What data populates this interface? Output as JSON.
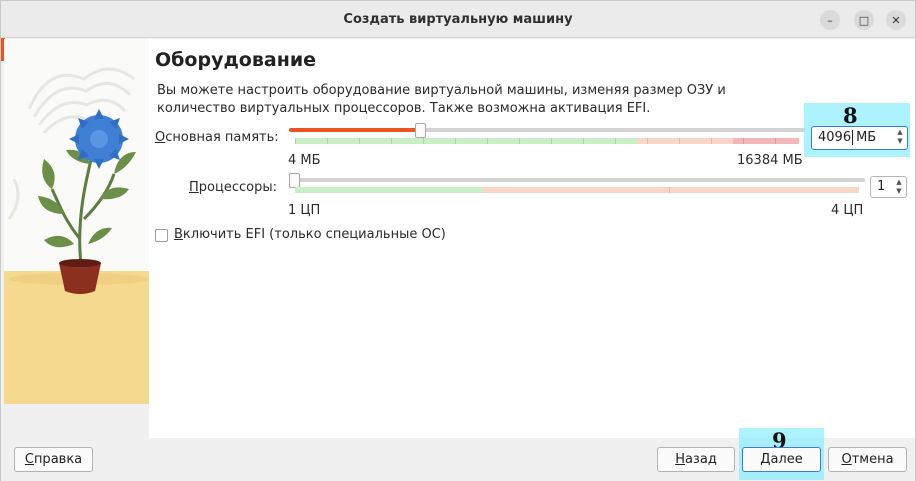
{
  "window": {
    "title": "Создать виртуальную машину",
    "controls": [
      "–",
      "□",
      "✕"
    ]
  },
  "page": {
    "heading": "Оборудование",
    "description": "Вы можете настроить оборудование виртуальной машины, изменяя размер ОЗУ и количество виртуальных процессоров. Также возможна активация EFI."
  },
  "memory": {
    "label": "Основная память:",
    "underline_char": "О",
    "label_rest": "сновная память:",
    "min_label": "4 МБ",
    "max_label": "16384 МБ",
    "value": "4096",
    "unit": "МБ",
    "slider_fraction": 0.25
  },
  "cpu": {
    "label_underline": "П",
    "label_rest": "роцессоры:",
    "min_label": "1 ЦП",
    "max_label": "4 ЦП",
    "value": "1",
    "slider_fraction": 0
  },
  "efi": {
    "underline_char": "В",
    "label_rest": "ключить EFI (только специальные ОС)",
    "checked": false
  },
  "annotations": {
    "memory_field_marker": "8",
    "next_button_marker": "9"
  },
  "buttons": {
    "help_u": "С",
    "help_rest": "правка",
    "back_u": "Н",
    "back_rest": "азад",
    "next_u": "Д",
    "next_rest": "алее",
    "cancel_u": "О",
    "cancel_rest": "тмена"
  },
  "colors": {
    "accent": "#e95420",
    "green_zone": "#c8f0c4",
    "orange_zone": "#f8d6c8",
    "red_zone": "#f4b6b6",
    "highlight": "#80ecff"
  },
  "icons": {
    "spin_up": "▲",
    "spin_down": "▼"
  }
}
